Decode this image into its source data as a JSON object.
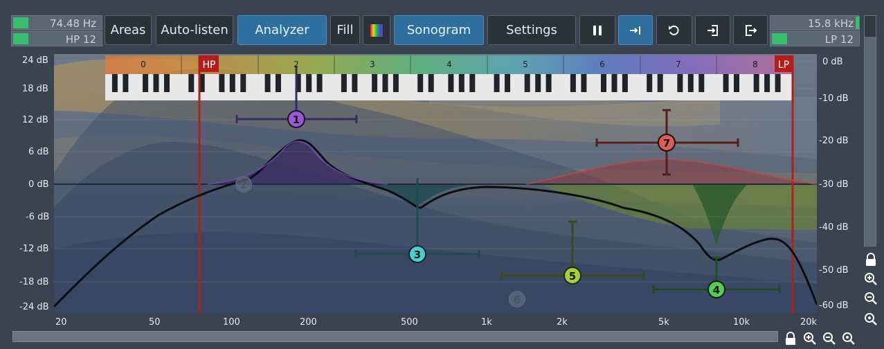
{
  "left_fields": {
    "low_freq": "74.48 Hz",
    "low_filter": "HP 12"
  },
  "right_fields": {
    "high_freq": "15.8 kHz",
    "high_filter": "LP 12"
  },
  "buttons": {
    "areas": "Areas",
    "auto_listen": "Auto-listen",
    "analyzer": "Analyzer",
    "fill": "Fill",
    "sonogram": "Sonogram",
    "settings": "Settings"
  },
  "icons": [
    "color-spectrum-icon",
    "pause-icon",
    "go-to-end-icon",
    "undo-icon",
    "import-icon",
    "export-icon",
    "lock-icon",
    "zoom-in-icon",
    "zoom-out-icon",
    "zoom-reset-icon"
  ],
  "y_axis_left": [
    "24 dB",
    "18 dB",
    "12 dB",
    "6 dB",
    "0 dB",
    "-6 dB",
    "-12 dB",
    "-18 dB",
    "-24 dB"
  ],
  "y_axis_right": [
    "0 dB",
    "-10 dB",
    "-20 dB",
    "-30 dB",
    "-40 dB",
    "-50 dB",
    "-60 dB"
  ],
  "x_axis": [
    "20",
    "50",
    "100",
    "200",
    "500",
    "1k",
    "2k",
    "5k",
    "10k",
    "20k"
  ],
  "octaves": [
    "0",
    "1",
    "2",
    "3",
    "4",
    "5",
    "6",
    "7",
    "8"
  ],
  "filter_tags": {
    "hp": "HP",
    "lp": "LP"
  },
  "bands": [
    {
      "id": "1",
      "color": "#9a58d8",
      "freq": 190,
      "gain": 7.8
    },
    {
      "id": "2",
      "color": "#6a7788",
      "freq": 130,
      "gain": 0.0
    },
    {
      "id": "3",
      "color": "#46d0cf",
      "freq": 520,
      "gain": -12.5
    },
    {
      "id": "4",
      "color": "#55cc55",
      "freq": 8500,
      "gain": -19.5
    },
    {
      "id": "5",
      "color": "#a8d035",
      "freq": 2200,
      "gain": -16.5
    },
    {
      "id": "6",
      "color": "#6a7788",
      "freq": 850,
      "gain": -20.5
    },
    {
      "id": "7",
      "color": "#e05a5a",
      "freq": 6200,
      "gain": 7.0
    }
  ],
  "colors": {
    "accent": "#2e6fa0",
    "hp_lp": "#b71c1c",
    "active_meter": "#35c070"
  }
}
